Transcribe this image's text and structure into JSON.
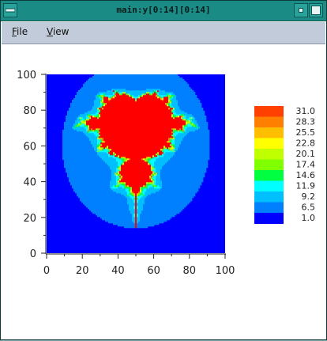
{
  "window": {
    "title": "main:y[0:14][0:14]",
    "menu": [
      {
        "label": "File",
        "underline": "F",
        "rest": "ile"
      },
      {
        "label": "View",
        "underline": "V",
        "rest": "iew"
      }
    ]
  },
  "colors": {
    "titlebar": "#1a8c85",
    "menubar": "#c2cbd9",
    "background": "#0000ff",
    "set_interior": "#ff0000"
  },
  "chart_data": {
    "type": "heatmap",
    "title": "",
    "xlabel": "",
    "ylabel": "",
    "xlim": [
      0,
      100
    ],
    "ylim": [
      0,
      100
    ],
    "xticks": [
      "0",
      "20",
      "40",
      "60",
      "80",
      "100"
    ],
    "yticks": [
      "0",
      "20",
      "40",
      "60",
      "80",
      "100"
    ],
    "colorbar": {
      "labels": [
        "31.0",
        "28.3",
        "25.5",
        "22.8",
        "20.1",
        "17.4",
        "14.6",
        "11.9",
        "9.2",
        "6.5",
        "1.0"
      ],
      "colors": [
        "#ff4000",
        "#ff8000",
        "#ffbf00",
        "#ffff00",
        "#bfff00",
        "#80ff00",
        "#00ff40",
        "#00ffff",
        "#00bfff",
        "#0080ff",
        "#0000ff"
      ]
    },
    "grid": false
  }
}
